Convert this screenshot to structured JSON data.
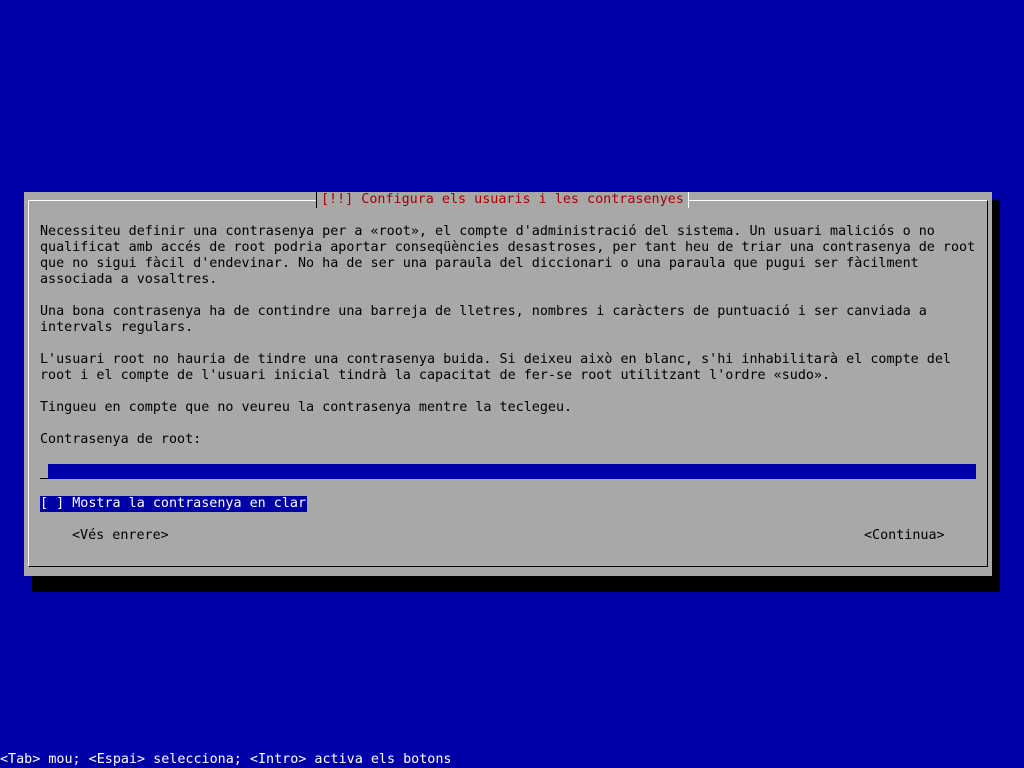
{
  "dialog": {
    "title": "[!!] Configura els usuaris i les contrasenyes",
    "paragraphs": [
      [
        "Necessiteu definir una contrasenya per a «root», el compte d'administració del sistema. Un usuari maliciós o no",
        "qualificat amb accés de root podria aportar conseqüències desastroses, per tant heu de triar una contrasenya de root",
        "que no sigui fàcil d'endevinar. No ha de ser una paraula del diccionari o una paraula que pugui ser fàcilment",
        "associada a vosaltres."
      ],
      [
        "Una bona contrasenya ha de contindre una barreja de lletres, nombres i caràcters de puntuació i ser canviada a",
        "intervals regulars."
      ],
      [
        "L'usuari root no hauria de tindre una contrasenya buida. Si deixeu això en blanc, s'hi inhabilitarà el compte del",
        "root i el compte de l'usuari inicial tindrà la capacitat de fer-se root utilitzant l'ordre «sudo»."
      ],
      [
        "Tingueu en compte que no veureu la contrasenya mentre la teclegeu."
      ]
    ],
    "field_label": "Contrasenya de root:",
    "password_value": "",
    "checkbox_label": "[ ] Mostra la contrasenya en clar",
    "checkbox_checked": false,
    "back_button": "<Vés enrere>",
    "continue_button": "<Continua>"
  },
  "status_bar": "<Tab> mou; <Espai> selecciona; <Intro> activa els botons",
  "colors": {
    "background": "#0000a8",
    "dialog": "#a8a8a8",
    "title": "#a80000",
    "highlight": "#0000a8",
    "text": "#000000",
    "status_text": "#ffffff"
  }
}
